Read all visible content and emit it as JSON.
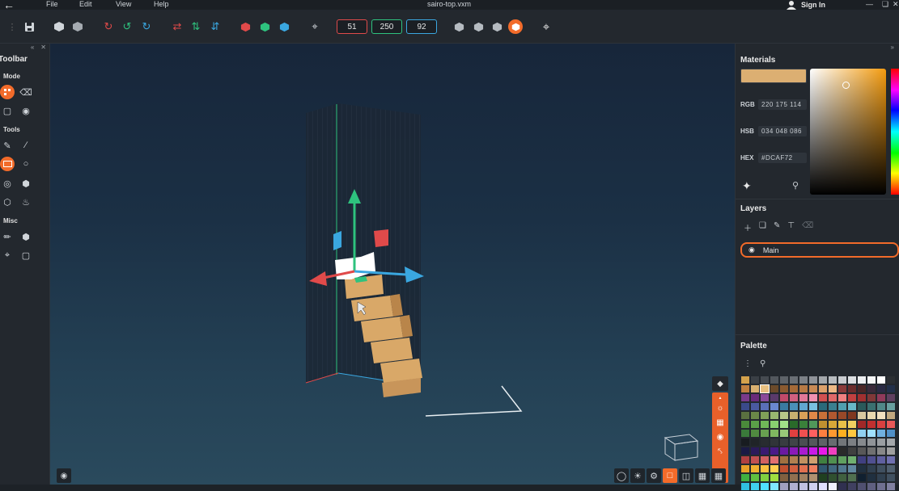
{
  "app": {
    "title": "sairo-top.vxm",
    "sign_in": "Sign In"
  },
  "menu": {
    "file": "File",
    "edit": "Edit",
    "view": "View",
    "help": "Help"
  },
  "toolbar": {
    "dim_x": "51",
    "dim_y": "250",
    "dim_z": "92",
    "colors": {
      "x": "#e04a4a",
      "y": "#2ec27e",
      "z": "#3aa7e0",
      "accent": "#f26b2a"
    }
  },
  "left": {
    "title": "Toolbar",
    "mode": "Mode",
    "tools": "Tools",
    "misc": "Misc"
  },
  "materials": {
    "title": "Materials",
    "color": "#DCAF72",
    "rgb_label": "RGB",
    "rgb": "220 175 114",
    "hsb_label": "HSB",
    "hsb": "034 048 086",
    "hex_label": "HEX",
    "hex": "#DCAF72"
  },
  "layers": {
    "title": "Layers",
    "items": [
      {
        "name": "Main"
      }
    ]
  },
  "palette": {
    "title": "Palette",
    "colors": [
      "#d4a24c",
      "#3a3f45",
      "#464b51",
      "#52575d",
      "#5e6369",
      "#6a6f75",
      "#7c8187",
      "#8f9399",
      "#a3a7ab",
      "#b7bbbf",
      "#c9ccd0",
      "#dcdfe2",
      "#eceef0",
      "#f5f6f7",
      "#ffffff",
      "#2b2f33",
      "#c08040",
      "#d9b070",
      "#e8c080",
      "#6b4a2a",
      "#8a5a30",
      "#a56a38",
      "#b77a45",
      "#c98a55",
      "#dca06a",
      "#edb885",
      "#8a3a3a",
      "#6b2c2c",
      "#4a2626",
      "#3a2a3a",
      "#2a2a44",
      "#22304a",
      "#7a3a8a",
      "#6a2a7a",
      "#8a4a9a",
      "#5a3a6a",
      "#c04a6a",
      "#d06080",
      "#e07898",
      "#f090b0",
      "#d05050",
      "#e06868",
      "#f08080",
      "#c04040",
      "#a03030",
      "#803838",
      "#903a5a",
      "#604060",
      "#3a4a8a",
      "#4a5aa0",
      "#5a70b8",
      "#6a88d0",
      "#3a7aa0",
      "#4a90b8",
      "#60a8d0",
      "#78c0e0",
      "#2a6a7a",
      "#3a8090",
      "#50a0b0",
      "#68b8c8",
      "#2a5a5a",
      "#3a7070",
      "#508888",
      "#68a0a0",
      "#5a7040",
      "#6a8848",
      "#80a058",
      "#98b870",
      "#b8c888",
      "#c8b070",
      "#d8a058",
      "#e08848",
      "#c87038",
      "#b05830",
      "#984828",
      "#803820",
      "#d8c8a0",
      "#e8d8b0",
      "#f0e0c0",
      "#c0a880",
      "#4a8a3a",
      "#5aa048",
      "#70b858",
      "#88d070",
      "#a0e088",
      "#2a6a2a",
      "#3a803a",
      "#50985a",
      "#c09030",
      "#d8a838",
      "#e8c048",
      "#f0d060",
      "#a02828",
      "#c03030",
      "#d84040",
      "#e85858",
      "#3a7a3a",
      "#508a40",
      "#68a050",
      "#80b860",
      "#98c878",
      "#e04040",
      "#f05050",
      "#ff6060",
      "#ff8040",
      "#ff9a30",
      "#ffb020",
      "#ffc840",
      "#90d0f0",
      "#a0e0ff",
      "#70b0e0",
      "#5090c8",
      "#181c20",
      "#202428",
      "#282c30",
      "#303438",
      "#383c40",
      "#404448",
      "#4a4e52",
      "#54585c",
      "#5e6266",
      "#686c70",
      "#72767a",
      "#7c8084",
      "#868a8e",
      "#909498",
      "#9a9ea2",
      "#a4a8ac",
      "#1a1a44",
      "#2a1a5a",
      "#3a1a70",
      "#4a1a88",
      "#6a1aa0",
      "#8a1ab8",
      "#aa1ad0",
      "#ca1ae8",
      "#e81ae8",
      "#f040c0",
      "#2a2a2a",
      "#404040",
      "#585858",
      "#707070",
      "#888888",
      "#a0a0a0",
      "#b04040",
      "#c05050",
      "#d06060",
      "#e07070",
      "#a07040",
      "#b08050",
      "#c09060",
      "#d0a070",
      "#408040",
      "#509050",
      "#60a060",
      "#70b070",
      "#404080",
      "#505090",
      "#6060a0",
      "#7070b0",
      "#e8a028",
      "#f0b030",
      "#f8c040",
      "#ffd050",
      "#c05030",
      "#d06040",
      "#e07050",
      "#f08060",
      "#305870",
      "#406880",
      "#507890",
      "#6088a0",
      "#203040",
      "#304050",
      "#405060",
      "#506070",
      "#40b040",
      "#60c040",
      "#80d040",
      "#a0e040",
      "#806040",
      "#907050",
      "#a08060",
      "#b09070",
      "#204020",
      "#305030",
      "#406040",
      "#507050",
      "#102030",
      "#203040",
      "#304050",
      "#405060",
      "#30c0e0",
      "#40d0f0",
      "#50e0ff",
      "#80e8ff",
      "#a0a0c0",
      "#b0b0d0",
      "#c0c0e0",
      "#d0d0f0",
      "#e0e0ff",
      "#f0f0ff",
      "#303050",
      "#404060",
      "#505070",
      "#606080",
      "#707090",
      "#8080a0"
    ]
  }
}
